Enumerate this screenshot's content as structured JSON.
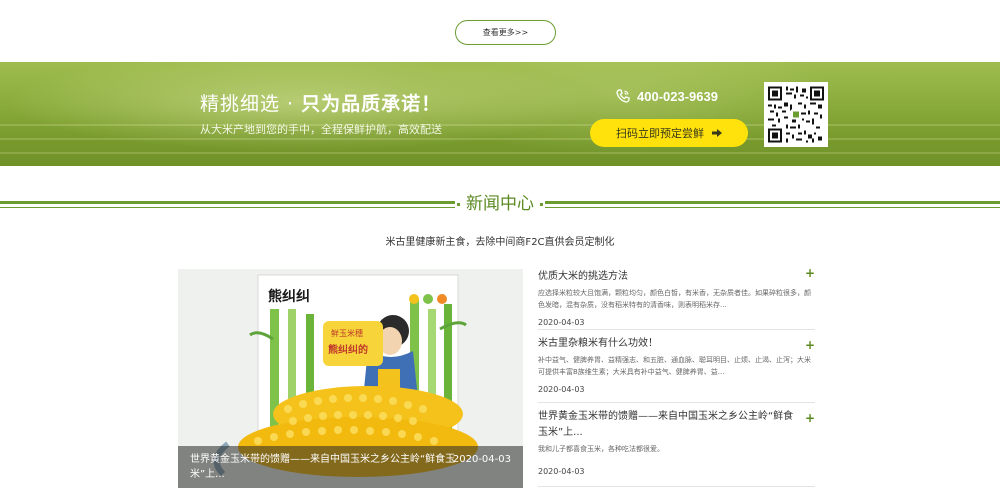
{
  "more": {
    "label": "查看更多>>"
  },
  "banner": {
    "title_thin": "精挑细选 · ",
    "title_bold": "只为品质承诺！",
    "subtitle": "从大米产地到您的手中，全程保鲜护航，高效配送",
    "phone": "400-023-9639",
    "order_label": "扫码立即预定尝鲜",
    "accent": "#ffe10b"
  },
  "news": {
    "title": "新闻中心",
    "description": "米古里健康新主食，去除中间商F2C直供会员定制化",
    "feature": {
      "caption": "世界黄金玉米带的馈赠——来自中国玉米之乡公主岭“鲜食玉米”上...",
      "date": "2020-04-03",
      "package_text": "熊纠纠",
      "package_sub1": "鲜玉米穗",
      "package_sub2": "熊纠纠的"
    },
    "items": [
      {
        "title": "优质大米的挑选方法",
        "body": "应选择米粒较大且饱满，颗粒均匀，颜色白皙，有米香，无杂质者佳。如果碎粒很多，颜色发暗，混有杂质，没有稻米特有的清香味，则表明稻米存...",
        "date": "2020-04-03"
      },
      {
        "title": "米古里杂粮米有什么功效！",
        "body": "补中益气、健脾养胃、益精强志、和五脏、通血脉、聪耳明目、止烦、止渴、止泻；大米可提供丰富B族维生素；大米具有补中益气、健脾养胃、益...",
        "date": "2020-04-03"
      },
      {
        "title": "世界黄金玉米带的馈赠——来自中国玉米之乡公主岭“鲜食玉米”上...",
        "body": "我和儿子都喜食玉米，各种吃法都很爱。",
        "date": "2020-04-03"
      }
    ],
    "plus_label": "+",
    "brand_color": "#6a9c2f"
  }
}
